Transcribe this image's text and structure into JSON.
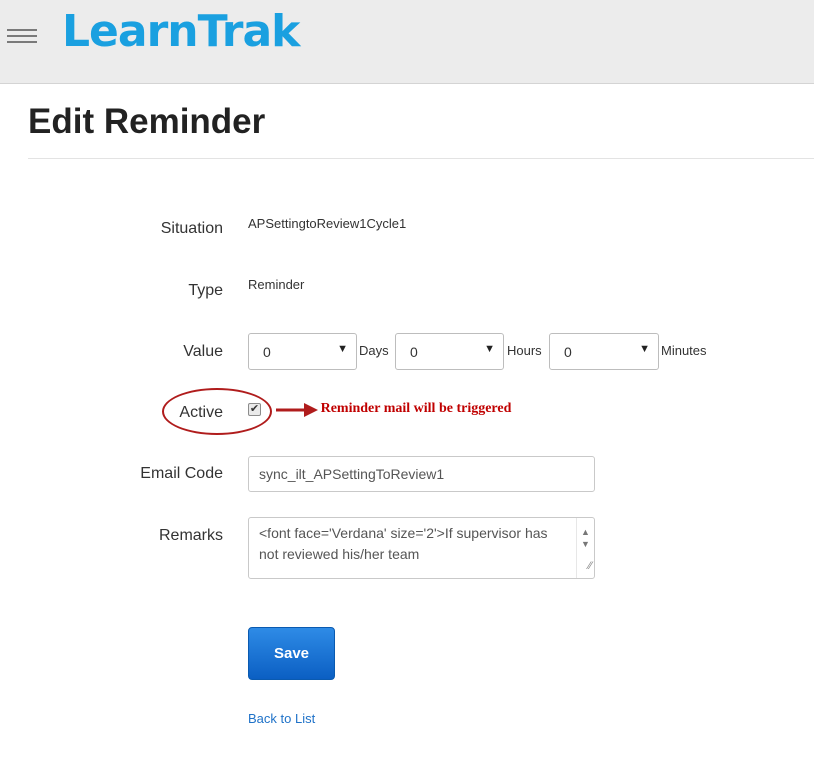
{
  "header": {
    "logo_text": "LearnTrak"
  },
  "page": {
    "title": "Edit Reminder"
  },
  "form": {
    "situation": {
      "label": "Situation",
      "value": "APSettingtoReview1Cycle1"
    },
    "type": {
      "label": "Type",
      "value": "Reminder"
    },
    "value": {
      "label": "Value",
      "days": {
        "selected": "0",
        "unit": "Days"
      },
      "hours": {
        "selected": "0",
        "unit": "Hours"
      },
      "minutes": {
        "selected": "0",
        "unit": "Minutes"
      }
    },
    "active": {
      "label": "Active",
      "checked": true
    },
    "email_code": {
      "label": "Email Code",
      "value": "sync_ilt_APSettingToReview1"
    },
    "remarks": {
      "label": "Remarks",
      "value": "<font face='Verdana' size='2'>If supervisor has not reviewed his/her team"
    },
    "save_label": "Save",
    "back_link_label": "Back to List"
  },
  "annotation": {
    "text": "Reminder mail will be triggered",
    "color": "#c00000"
  },
  "icons": {
    "menu": "hamburger-icon",
    "dropdown": "caret-down-icon",
    "check": "check-icon"
  },
  "colors": {
    "brand": "#1aa0e0",
    "button": "#0b5fc3",
    "link": "#1f72c8"
  }
}
